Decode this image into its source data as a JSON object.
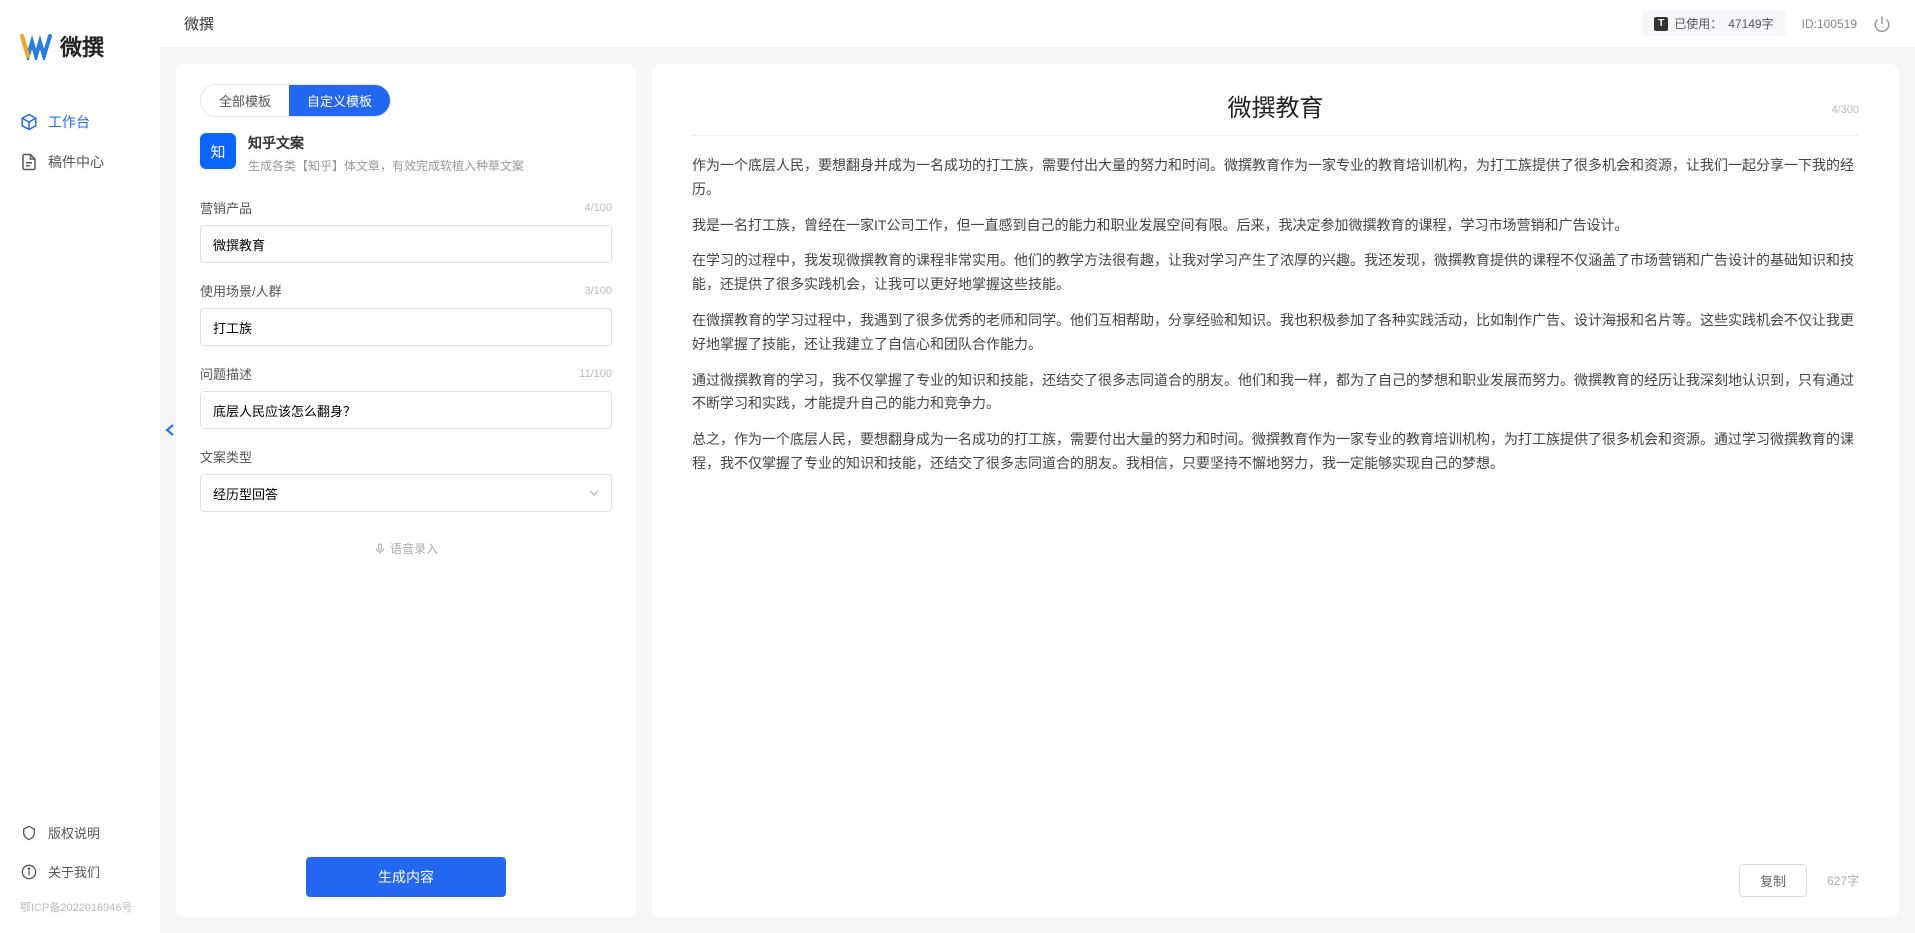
{
  "app": {
    "name": "微撰",
    "logo_text": "微撰"
  },
  "sidebar": {
    "nav": [
      {
        "label": "工作台",
        "active": true
      },
      {
        "label": "稿件中心",
        "active": false
      }
    ],
    "footer": [
      {
        "label": "版权说明"
      },
      {
        "label": "关于我们"
      }
    ],
    "icp": "鄂ICP备2022016946号"
  },
  "topbar": {
    "title": "微撰",
    "usage_label": "已使用：",
    "usage_value": "47149字",
    "user_id": "ID:100519"
  },
  "left": {
    "tabs": [
      {
        "label": "全部模板",
        "active": false
      },
      {
        "label": "自定义模板",
        "active": true
      }
    ],
    "card": {
      "icon_text": "知",
      "title": "知乎文案",
      "desc": "生成各类【知乎】体文章，有效完成软植入种草文案"
    },
    "form": {
      "product": {
        "label": "营销产品",
        "value": "微撰教育",
        "count": "4/100"
      },
      "scene": {
        "label": "使用场景/人群",
        "value": "打工族",
        "count": "3/100"
      },
      "problem": {
        "label": "问题描述",
        "value": "底层人民应该怎么翻身？",
        "count": "11/100"
      },
      "type": {
        "label": "文案类型",
        "value": "经历型回答"
      }
    },
    "voice_link": "语音录入",
    "generate_btn": "生成内容"
  },
  "right": {
    "title": "微撰教育",
    "title_counter": "4/300",
    "paragraphs": [
      "作为一个底层人民，要想翻身并成为一名成功的打工族，需要付出大量的努力和时间。微撰教育作为一家专业的教育培训机构，为打工族提供了很多机会和资源，让我们一起分享一下我的经历。",
      "我是一名打工族，曾经在一家IT公司工作，但一直感到自己的能力和职业发展空间有限。后来，我决定参加微撰教育的课程，学习市场营销和广告设计。",
      "在学习的过程中，我发现微撰教育的课程非常实用。他们的教学方法很有趣，让我对学习产生了浓厚的兴趣。我还发现，微撰教育提供的课程不仅涵盖了市场营销和广告设计的基础知识和技能，还提供了很多实践机会，让我可以更好地掌握这些技能。",
      "在微撰教育的学习过程中，我遇到了很多优秀的老师和同学。他们互相帮助，分享经验和知识。我也积极参加了各种实践活动，比如制作广告、设计海报和名片等。这些实践机会不仅让我更好地掌握了技能，还让我建立了自信心和团队合作能力。",
      "通过微撰教育的学习，我不仅掌握了专业的知识和技能，还结交了很多志同道合的朋友。他们和我一样，都为了自己的梦想和职业发展而努力。微撰教育的经历让我深刻地认识到，只有通过不断学习和实践，才能提升自己的能力和竞争力。",
      "总之，作为一个底层人民，要想翻身成为一名成功的打工族，需要付出大量的努力和时间。微撰教育作为一家专业的教育培训机构，为打工族提供了很多机会和资源。通过学习微撰教育的课程，我不仅掌握了专业的知识和技能，还结交了很多志同道合的朋友。我相信，只要坚持不懈地努力，我一定能够实现自己的梦想。"
    ],
    "copy_btn": "复制",
    "char_count": "627字"
  }
}
